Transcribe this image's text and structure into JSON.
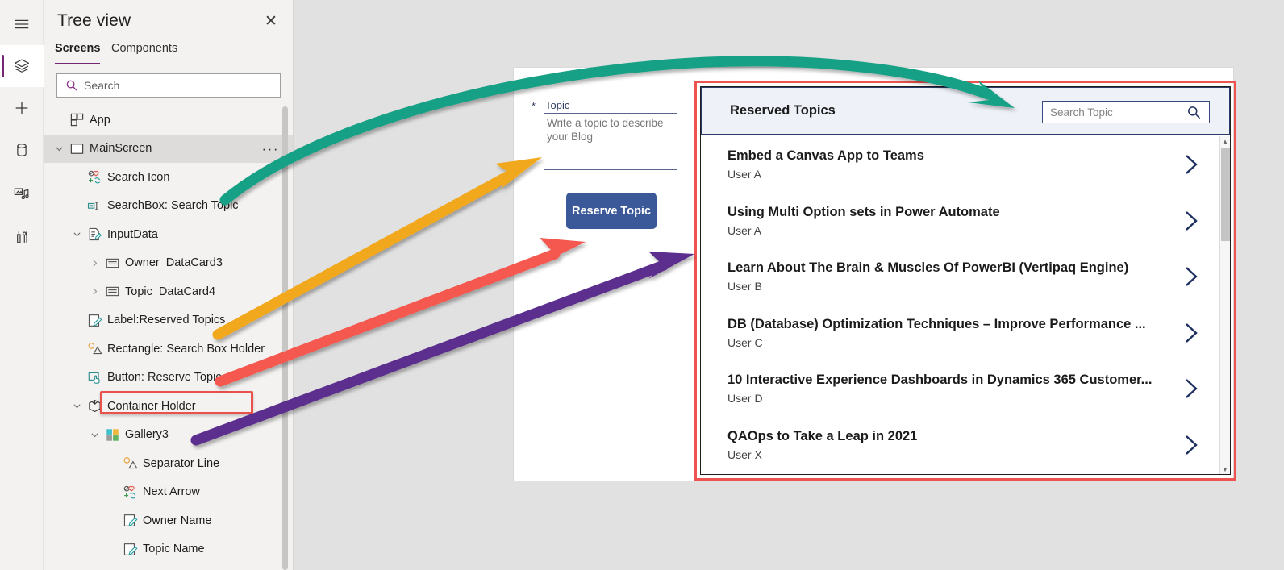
{
  "rail": {
    "items": [
      {
        "name": "hamburger-menu-icon",
        "active": false
      },
      {
        "name": "tree-view-layers-icon",
        "active": true
      },
      {
        "name": "insert-plus-icon",
        "active": false
      },
      {
        "name": "data-cylinder-icon",
        "active": false
      },
      {
        "name": "media-icon",
        "active": false
      },
      {
        "name": "advanced-tools-icon",
        "active": false
      }
    ]
  },
  "tree_panel": {
    "title": "Tree view",
    "close_icon": "✕",
    "tabs": [
      {
        "label": "Screens",
        "selected": true
      },
      {
        "label": "Components",
        "selected": false
      }
    ],
    "search": {
      "placeholder": "Search",
      "value": "",
      "icon": "search-icon"
    },
    "items": [
      {
        "label": "App",
        "indent": 0,
        "chevron": "none",
        "icon": "app-icon",
        "selected": false,
        "highlighted": false,
        "overflow": false
      },
      {
        "label": "MainScreen",
        "indent": 0,
        "chevron": "down",
        "icon": "screen-icon",
        "selected": true,
        "highlighted": false,
        "overflow": true
      },
      {
        "label": "Search Icon",
        "indent": 1,
        "chevron": "none",
        "icon": "icon-control",
        "selected": false,
        "highlighted": false,
        "overflow": false
      },
      {
        "label": "SearchBox: Search Topic",
        "indent": 1,
        "chevron": "none",
        "icon": "textinput-icon",
        "selected": false,
        "highlighted": false,
        "overflow": false
      },
      {
        "label": "InputData",
        "indent": 1,
        "chevron": "down",
        "icon": "form-icon",
        "selected": false,
        "highlighted": false,
        "overflow": false
      },
      {
        "label": "Owner_DataCard3",
        "indent": 2,
        "chevron": "right",
        "icon": "datacard-icon",
        "selected": false,
        "highlighted": false,
        "overflow": false
      },
      {
        "label": "Topic_DataCard4",
        "indent": 2,
        "chevron": "right",
        "icon": "datacard-icon",
        "selected": false,
        "highlighted": false,
        "overflow": false
      },
      {
        "label": "Label:Reserved Topics",
        "indent": 1,
        "chevron": "none",
        "icon": "label-icon",
        "selected": false,
        "highlighted": false,
        "overflow": false
      },
      {
        "label": "Rectangle: Search Box Holder",
        "indent": 1,
        "chevron": "none",
        "icon": "shape-icon",
        "selected": false,
        "highlighted": false,
        "overflow": false
      },
      {
        "label": "Button: Reserve Topic",
        "indent": 1,
        "chevron": "none",
        "icon": "button-icon",
        "selected": false,
        "highlighted": false,
        "overflow": false
      },
      {
        "label": "Container Holder",
        "indent": 1,
        "chevron": "down",
        "icon": "container-icon",
        "selected": false,
        "highlighted": true,
        "overflow": false
      },
      {
        "label": "Gallery3",
        "indent": 2,
        "chevron": "down",
        "icon": "gallery-icon",
        "selected": false,
        "highlighted": false,
        "overflow": false
      },
      {
        "label": "Separator Line",
        "indent": 3,
        "chevron": "none",
        "icon": "shape-icon",
        "selected": false,
        "highlighted": false,
        "overflow": false
      },
      {
        "label": "Next Arrow",
        "indent": 3,
        "chevron": "none",
        "icon": "icon-control",
        "selected": false,
        "highlighted": false,
        "overflow": false
      },
      {
        "label": "Owner Name",
        "indent": 3,
        "chevron": "none",
        "icon": "label-icon",
        "selected": false,
        "highlighted": false,
        "overflow": false
      },
      {
        "label": "Topic Name",
        "indent": 3,
        "chevron": "none",
        "icon": "label-icon",
        "selected": false,
        "highlighted": false,
        "overflow": false
      }
    ],
    "overflow_dots": "···"
  },
  "canvas": {
    "form": {
      "required_mark": "*",
      "topic_label": "Topic",
      "topic_placeholder": "Write a topic to describe your Blog",
      "topic_value": ""
    },
    "reserve_button": {
      "label": "Reserve Topic",
      "color": "#3b5998"
    }
  },
  "gallery": {
    "title": "Reserved Topics",
    "search": {
      "placeholder": "Search Topic",
      "value": "",
      "icon": "search-icon"
    },
    "chevron_icon": "chevron-right-icon",
    "rows": [
      {
        "topic": "Embed a Canvas App to Teams",
        "owner": "User A"
      },
      {
        "topic": "Using Multi Option sets in Power Automate",
        "owner": "User A"
      },
      {
        "topic": "Learn About The Brain & Muscles Of PowerBI (Vertipaq Engine)",
        "owner": "User B"
      },
      {
        "topic": "DB (Database) Optimization Techniques – Improve Performance ...",
        "owner": "User C"
      },
      {
        "topic": "10 Interactive Experience Dashboards in Dynamics 365 Customer...",
        "owner": "User D"
      },
      {
        "topic": "QAOps to Take a Leap in 2021",
        "owner": "User X"
      }
    ],
    "scrollbar": {
      "up_arrow": "▲",
      "down_arrow": "▼"
    }
  },
  "annotations": {
    "highlight_color": "#ef5350",
    "arrows": [
      {
        "name": "green-arrow-searchbox",
        "color": "#17a085"
      },
      {
        "name": "orange-arrow-topic-card",
        "color": "#f2a81d"
      },
      {
        "name": "red-arrow-reserve-button",
        "color": "#f4584f"
      },
      {
        "name": "purple-arrow-container",
        "color": "#5b2d8e"
      }
    ]
  }
}
